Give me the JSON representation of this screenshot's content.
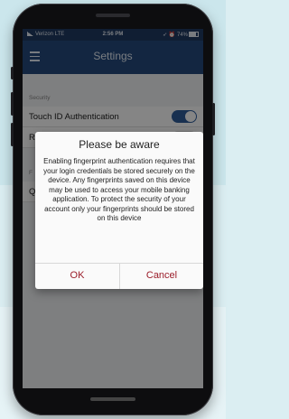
{
  "status_bar": {
    "carrier": "Verizon  LTE",
    "time": "2:56 PM",
    "right": "74%"
  },
  "nav": {
    "title": "Settings",
    "menu_icon": "hamburger-menu-icon"
  },
  "settings": {
    "section_security": "Security",
    "touch_id_label": "Touch ID Authentication",
    "touch_id_enabled": true,
    "row2_label": "R",
    "section_3": "F",
    "row3_label": "Q"
  },
  "dialog": {
    "title": "Please be aware",
    "message": "Enabling fingerprint authentication requires that your login credentials be stored securely on the device. Any fingerprints saved on this device may be used to access your mobile banking application. To protect the security of your account only your fingerprints should be stored on this device",
    "ok_label": "OK",
    "cancel_label": "Cancel"
  },
  "colors": {
    "nav_background": "#254a7d",
    "accent": "#2f5d9a",
    "dialog_button_text": "#9b1d2a"
  }
}
